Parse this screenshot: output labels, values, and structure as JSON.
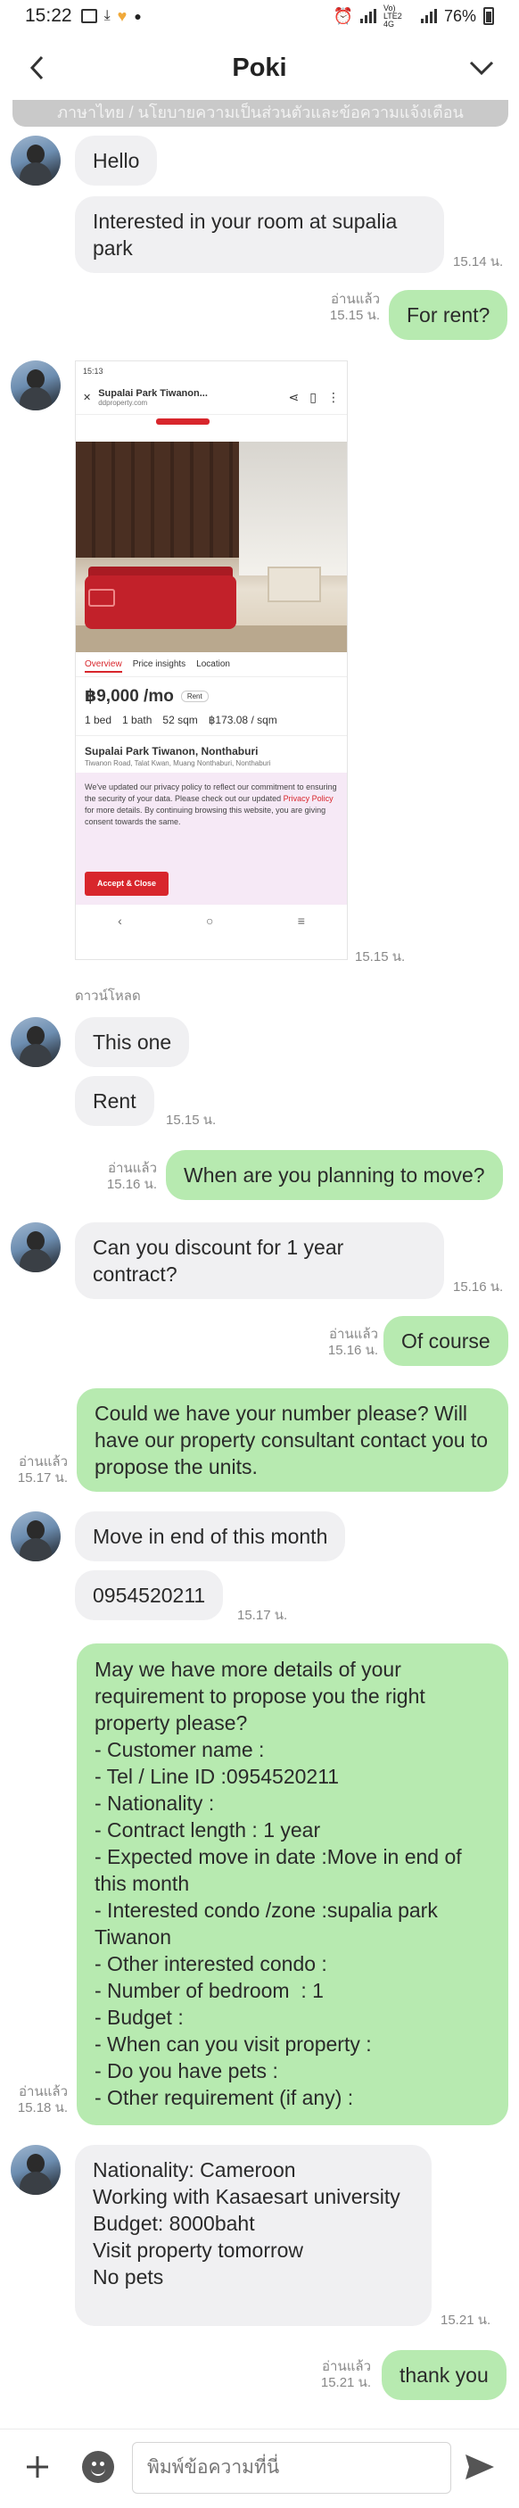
{
  "status_bar": {
    "time": "15:22",
    "network": "Vo) LTE2 4G",
    "battery": "76%"
  },
  "header": {
    "title": "Poki"
  },
  "notice_text": "ภาษาไทย / นโยบายความเป็นส่วนตัวและข้อความแจ้งเตือน",
  "messages": {
    "m1": {
      "text": "Hello"
    },
    "m2": {
      "text": "Interested in your room at supalia park",
      "time": "15.14 น."
    },
    "m3": {
      "text": "For rent?",
      "read": "อ่านแล้ว",
      "time": "15.15 น."
    },
    "m4": {
      "time": "15.15 น.",
      "download": "ดาวน์โหลด",
      "screenshot": {
        "status": "15:13",
        "site_name": "Supalai Park Tiwanon...",
        "site_url": "ddproperty.com",
        "tabs": [
          "Overview",
          "Price insights",
          "Location"
        ],
        "price": "฿9,000 /mo",
        "rent_tag": "Rent",
        "specs": [
          "1 bed",
          "1 bath",
          "52 sqm",
          "฿173.08 / sqm"
        ],
        "name": "Supalai Park Tiwanon, Nonthaburi",
        "address": "Tiwanon Road, Talat Kwan, Muang Nonthaburi, Nonthaburi",
        "privacy_text_1": "We've updated our privacy policy to reflect our commitment to ensuring the security of your data. Please check out our updated ",
        "privacy_link": "Privacy Policy",
        "privacy_text_2": " for more details. By continuing browsing this website, you are giving consent towards the same.",
        "accept": "Accept & Close"
      }
    },
    "m5": {
      "text": "This one"
    },
    "m6": {
      "text": "Rent",
      "time": "15.15 น."
    },
    "m7": {
      "text": "When are you planning to move?",
      "read": "อ่านแล้ว",
      "time": "15.16 น."
    },
    "m8": {
      "text": "Can you discount for 1 year contract?",
      "time": "15.16 น."
    },
    "m9": {
      "text": "Of course",
      "read": "อ่านแล้ว",
      "time": "15.16 น."
    },
    "m10": {
      "text": "Could we have your number please? Will have our property consultant contact you to propose the units.",
      "read": "อ่านแล้ว",
      "time": "15.17 น."
    },
    "m11": {
      "text": "Move in end of this month"
    },
    "m12": {
      "text": "0954520211",
      "time": "15.17 น."
    },
    "m13": {
      "text": "May we have more details of your requirement to propose you the right property please?\n- Customer name :\n- Tel / Line ID :0954520211\n- Nationality :\n- Contract length : 1 year\n- Expected move in date :Move in end of this month\n- Interested condo /zone :supalia park Tiwanon\n- Other interested condo :\n- Number of bedroom  : 1\n- Budget :\n- When can you visit property :\n- Do you have pets :\n- Other requirement (if any) :",
      "read": "อ่านแล้ว",
      "time": "15.18 น."
    },
    "m14": {
      "text": "Nationality: Cameroon\nWorking with Kasaesart university\nBudget: 8000baht\nVisit property tomorrow\nNo pets",
      "time": "15.21 น."
    },
    "m15": {
      "text": "thank you",
      "read": "อ่านแล้ว",
      "time": "15.21 น."
    }
  },
  "input": {
    "placeholder": "พิมพ์ข้อความที่นี่"
  },
  "colors": {
    "outgoing_bubble": "#b7eab0",
    "incoming_bubble": "#f0f0f2"
  }
}
